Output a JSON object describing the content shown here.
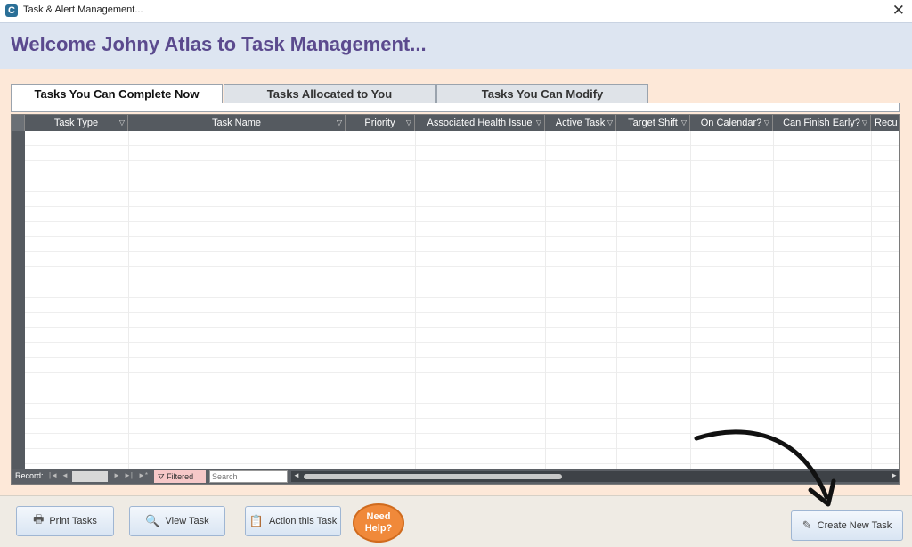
{
  "window": {
    "title": "Task & Alert Management...",
    "close_glyph": "✕"
  },
  "header": {
    "welcome": "Welcome Johny Atlas to Task Management..."
  },
  "tabs": [
    {
      "label": "Tasks You Can Complete Now",
      "active": true
    },
    {
      "label": "Tasks Allocated to You",
      "active": false
    },
    {
      "label": "Tasks You Can Modify",
      "active": false
    }
  ],
  "grid": {
    "columns": [
      "Task Type",
      "Task Name",
      "Priority",
      "Associated Health Issue",
      "Active Task",
      "Target Shift",
      "On Calendar?",
      "Can Finish Early?",
      "Recu"
    ],
    "rows": []
  },
  "record_nav": {
    "record_label": "Record:",
    "first": "|◄",
    "prev": "◄",
    "next": "►",
    "last": "►|",
    "new": "►*",
    "filtered_label": "Filtered",
    "search_placeholder": "Search"
  },
  "footer": {
    "print_label": "Print Tasks",
    "view_label": "View Task",
    "action_label": "Action this Task",
    "help_label": "Need Help?",
    "create_label": "Create New Task"
  },
  "icons": {
    "app": "app-logo-icon",
    "print": "printer-icon",
    "view": "view-task-icon",
    "action": "action-task-icon",
    "create": "create-task-icon",
    "filter": "filter-icon"
  },
  "colors": {
    "accent": "#5b4a8e",
    "help": "#f0893a",
    "header_bg": "#dde5f1",
    "body_bg": "#fde8d8"
  }
}
